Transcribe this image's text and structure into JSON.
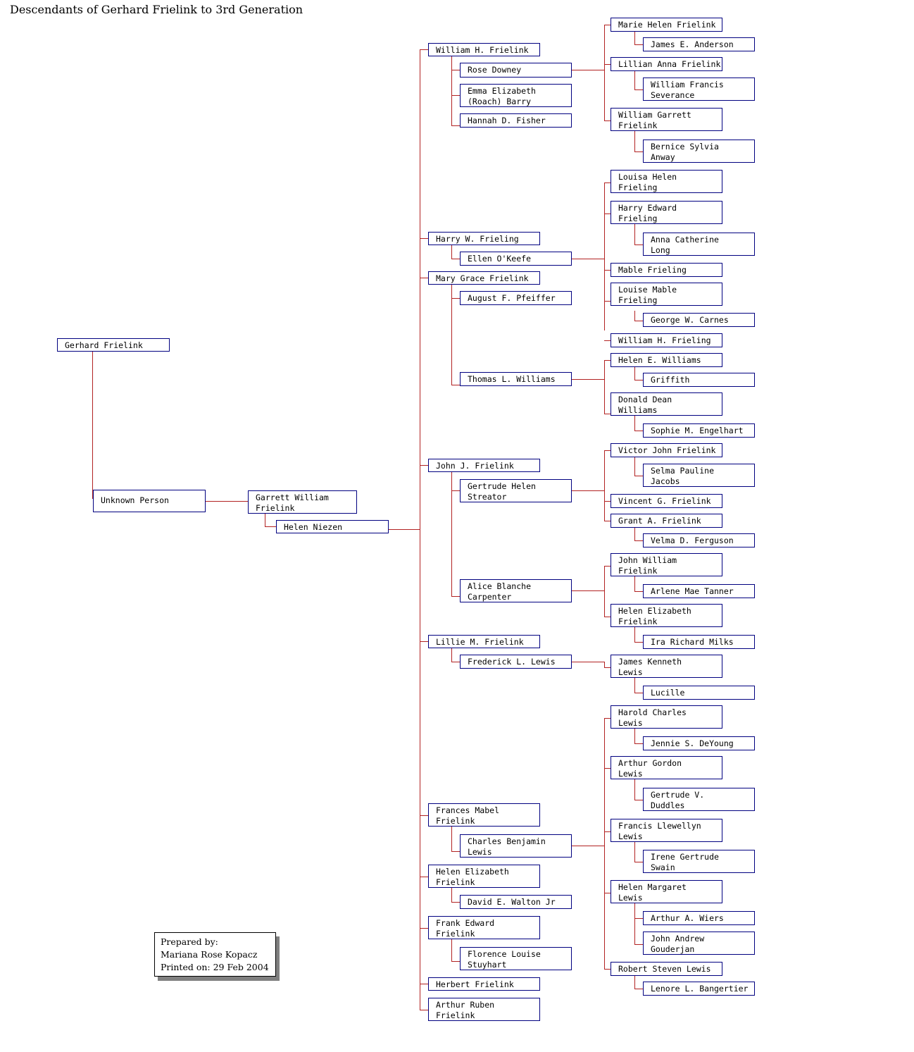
{
  "document": {
    "title": "Descendants of Gerhard Frielink to 3rd Generation"
  },
  "colors": {
    "box_border": "#000080",
    "connector": "#b22222",
    "text": "#000000",
    "background": "#ffffff",
    "prepared_border": "#000000",
    "prepared_shadow": "#808080"
  },
  "prepared_by": {
    "text": "Prepared by:\nMariana Rose Kopacz\nPrinted on: 29 Feb 2004",
    "label": "Prepared by:",
    "author": "Mariana Rose Kopacz",
    "printed_on": "Printed on: 29 Feb 2004"
  },
  "generations": {
    "g0": {
      "person": "Gerhard Frielink",
      "spouse": "Unknown Person"
    },
    "g1": {
      "person": "Garrett William\nFrielink",
      "spouse": "Helen Niezen"
    }
  },
  "nodes": {
    "gerhard_frielink": "Gerhard Frielink",
    "unknown_person": "Unknown Person",
    "garrett_william_frielink": "Garrett William\nFrielink",
    "helen_niezen": "Helen Niezen",
    "william_h_frielink": "William H. Frielink",
    "rose_downey": "Rose Downey",
    "emma_elizabeth_roach_barry": "Emma Elizabeth\n(Roach) Barry",
    "hannah_d_fisher": "Hannah D. Fisher",
    "marie_helen_frielink": "Marie Helen Frielink",
    "james_e_anderson": "James E. Anderson",
    "lillian_anna_frielink": "Lillian Anna Frielink",
    "william_francis_severance": "William Francis\nSeverance",
    "william_garrett_frielink": "William Garrett\nFrielink",
    "bernice_sylvia_anway": "Bernice Sylvia\nAnway",
    "harry_w_frieling": "Harry W. Frieling",
    "ellen_okeefe": "Ellen O'Keefe",
    "louisa_helen_frieling": "Louisa Helen\nFrieling",
    "harry_edward_frieling": "Harry Edward\nFrieling",
    "anna_catherine_long": "Anna Catherine\nLong",
    "mable_frieling": "Mable Frieling",
    "mary_grace_frielink": "Mary Grace Frielink",
    "august_f_pfeiffer": "August F. Pfeiffer",
    "thomas_l_williams": "Thomas L. Williams",
    "louise_mable_frieling": "Louise Mable\nFrieling",
    "george_w_carnes": "George W. Carnes",
    "william_h_frieling": "William H. Frieling",
    "helen_e_williams": "Helen E. Williams",
    "griffith": "Griffith",
    "donald_dean_williams": "Donald Dean\nWilliams",
    "sophie_m_engelhart": "Sophie M. Engelhart",
    "john_j_frielink": "John J. Frielink",
    "gertrude_helen_streator": "Gertrude Helen\nStreator",
    "alice_blanche_carpenter": "Alice Blanche\nCarpenter",
    "victor_john_frielink": "Victor John Frielink",
    "selma_pauline_jacobs": "Selma Pauline\nJacobs",
    "vincent_g_frielink": "Vincent G. Frielink",
    "grant_a_frielink": "Grant A. Frielink",
    "velma_d_ferguson": "Velma D. Ferguson",
    "john_william_frielink": "John William\nFrielink",
    "arlene_mae_tanner": "Arlene Mae Tanner",
    "helen_elizabeth_frielink_b": "Helen Elizabeth\nFrielink",
    "ira_richard_milks": "Ira Richard Milks",
    "lillie_m_frielink": "Lillie M. Frielink",
    "frederick_l_lewis": "Frederick L. Lewis",
    "james_kenneth_lewis": "James Kenneth\nLewis",
    "lucille": "Lucille",
    "frances_mabel_frielink": "Frances Mabel\nFrielink",
    "charles_benjamin_lewis": "Charles Benjamin\nLewis",
    "harold_charles_lewis": "Harold Charles\nLewis",
    "jennie_s_deyoung": "Jennie S. DeYoung",
    "arthur_gordon_lewis": "Arthur Gordon\nLewis",
    "gertrude_v_duddles": "Gertrude V.\nDuddles",
    "francis_llewellyn_lewis": "Francis Llewellyn\nLewis",
    "irene_gertrude_swain": "Irene Gertrude\nSwain",
    "helen_margaret_lewis": "Helen Margaret\nLewis",
    "arthur_a_wiers": "Arthur A. Wiers",
    "john_andrew_gouderjan": "John Andrew\nGouderjan",
    "robert_steven_lewis": "Robert Steven Lewis",
    "lenore_l_bangertier": "Lenore L. Bangertier",
    "helen_elizabeth_frielink_a": "Helen Elizabeth\nFrielink",
    "david_e_walton_jr": "David E. Walton Jr",
    "frank_edward_frielink": "Frank Edward\nFrielink",
    "florence_louise_stuyhart": "Florence Louise\nStuyhart",
    "herbert_frielink": "Herbert Frielink",
    "arthur_ruben_frielink": "Arthur Ruben\nFrielink"
  }
}
